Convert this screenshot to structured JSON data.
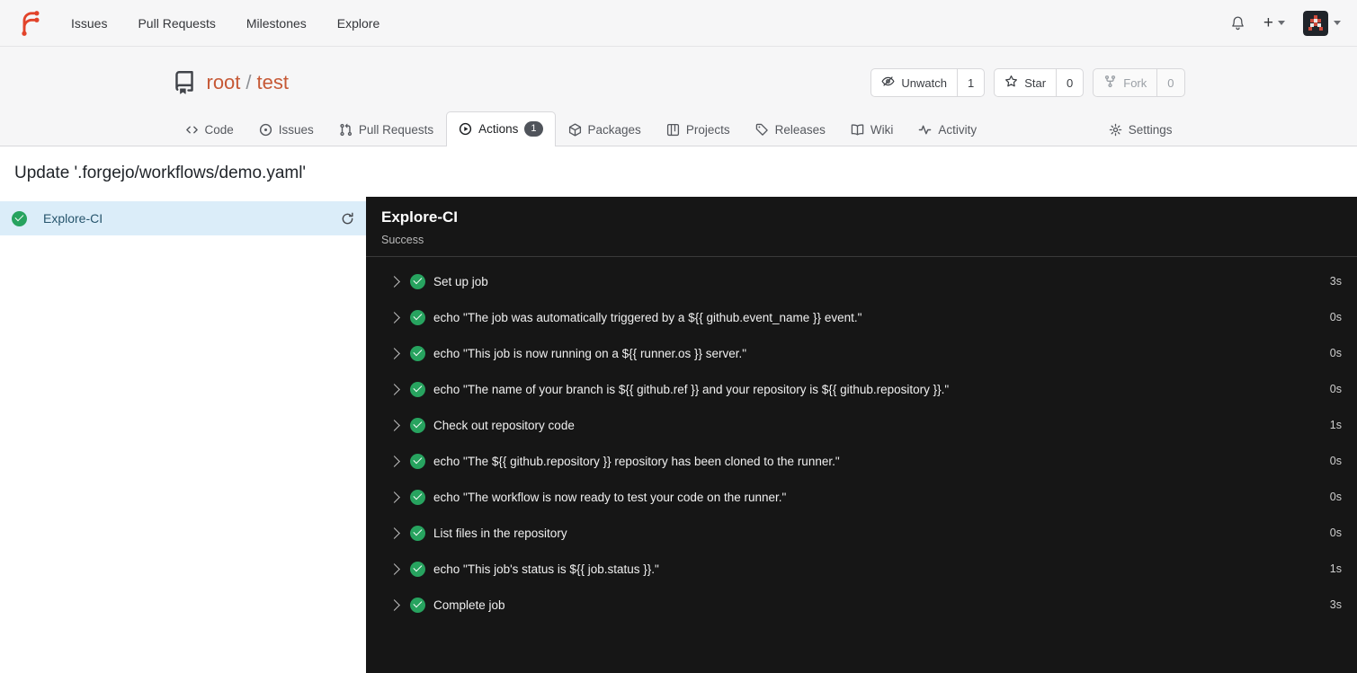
{
  "navbar": {
    "items": [
      {
        "label": "Issues"
      },
      {
        "label": "Pull Requests"
      },
      {
        "label": "Milestones"
      },
      {
        "label": "Explore"
      }
    ],
    "create_label": "+"
  },
  "repo": {
    "owner": "root",
    "separator": "/",
    "name": "test",
    "action_buttons": [
      {
        "label": "Unwatch",
        "count": "1"
      },
      {
        "label": "Star",
        "count": "0"
      },
      {
        "label": "Fork",
        "count": "0"
      }
    ]
  },
  "tabs": {
    "items": [
      {
        "label": "Code"
      },
      {
        "label": "Issues"
      },
      {
        "label": "Pull Requests"
      },
      {
        "label": "Actions",
        "count": "1",
        "active": true
      },
      {
        "label": "Packages"
      },
      {
        "label": "Projects"
      },
      {
        "label": "Releases"
      },
      {
        "label": "Wiki"
      },
      {
        "label": "Activity"
      }
    ],
    "settings_label": "Settings"
  },
  "page": {
    "commit_title": "Update '.forgejo/workflows/demo.yaml'"
  },
  "sidebar": {
    "jobs": [
      {
        "name": "Explore-CI",
        "status": "success"
      }
    ]
  },
  "panel": {
    "title": "Explore-CI",
    "status": "Success",
    "steps": [
      {
        "name": "Set up job",
        "duration": "3s"
      },
      {
        "name": "echo \"The job was automatically triggered by a ${{ github.event_name }} event.\"",
        "duration": "0s"
      },
      {
        "name": "echo \"This job is now running on a ${{ runner.os }} server.\"",
        "duration": "0s"
      },
      {
        "name": "echo \"The name of your branch is ${{ github.ref }} and your repository is ${{ github.repository }}.\"",
        "duration": "0s"
      },
      {
        "name": "Check out repository code",
        "duration": "1s"
      },
      {
        "name": "echo \"The ${{ github.repository }} repository has been cloned to the runner.\"",
        "duration": "0s"
      },
      {
        "name": "echo \"The workflow is now ready to test your code on the runner.\"",
        "duration": "0s"
      },
      {
        "name": "List files in the repository",
        "duration": "0s"
      },
      {
        "name": "echo \"This job's status is ${{ job.status }}.\"",
        "duration": "1s"
      },
      {
        "name": "Complete job",
        "duration": "3s"
      }
    ]
  },
  "colors": {
    "brand_orange": "#e2432a",
    "repo_link": "#c65936",
    "success_green": "#27a35f",
    "selected_job_bg": "#dbedf9",
    "log_panel_bg": "#161616",
    "tab_badge_bg": "#50545b"
  }
}
